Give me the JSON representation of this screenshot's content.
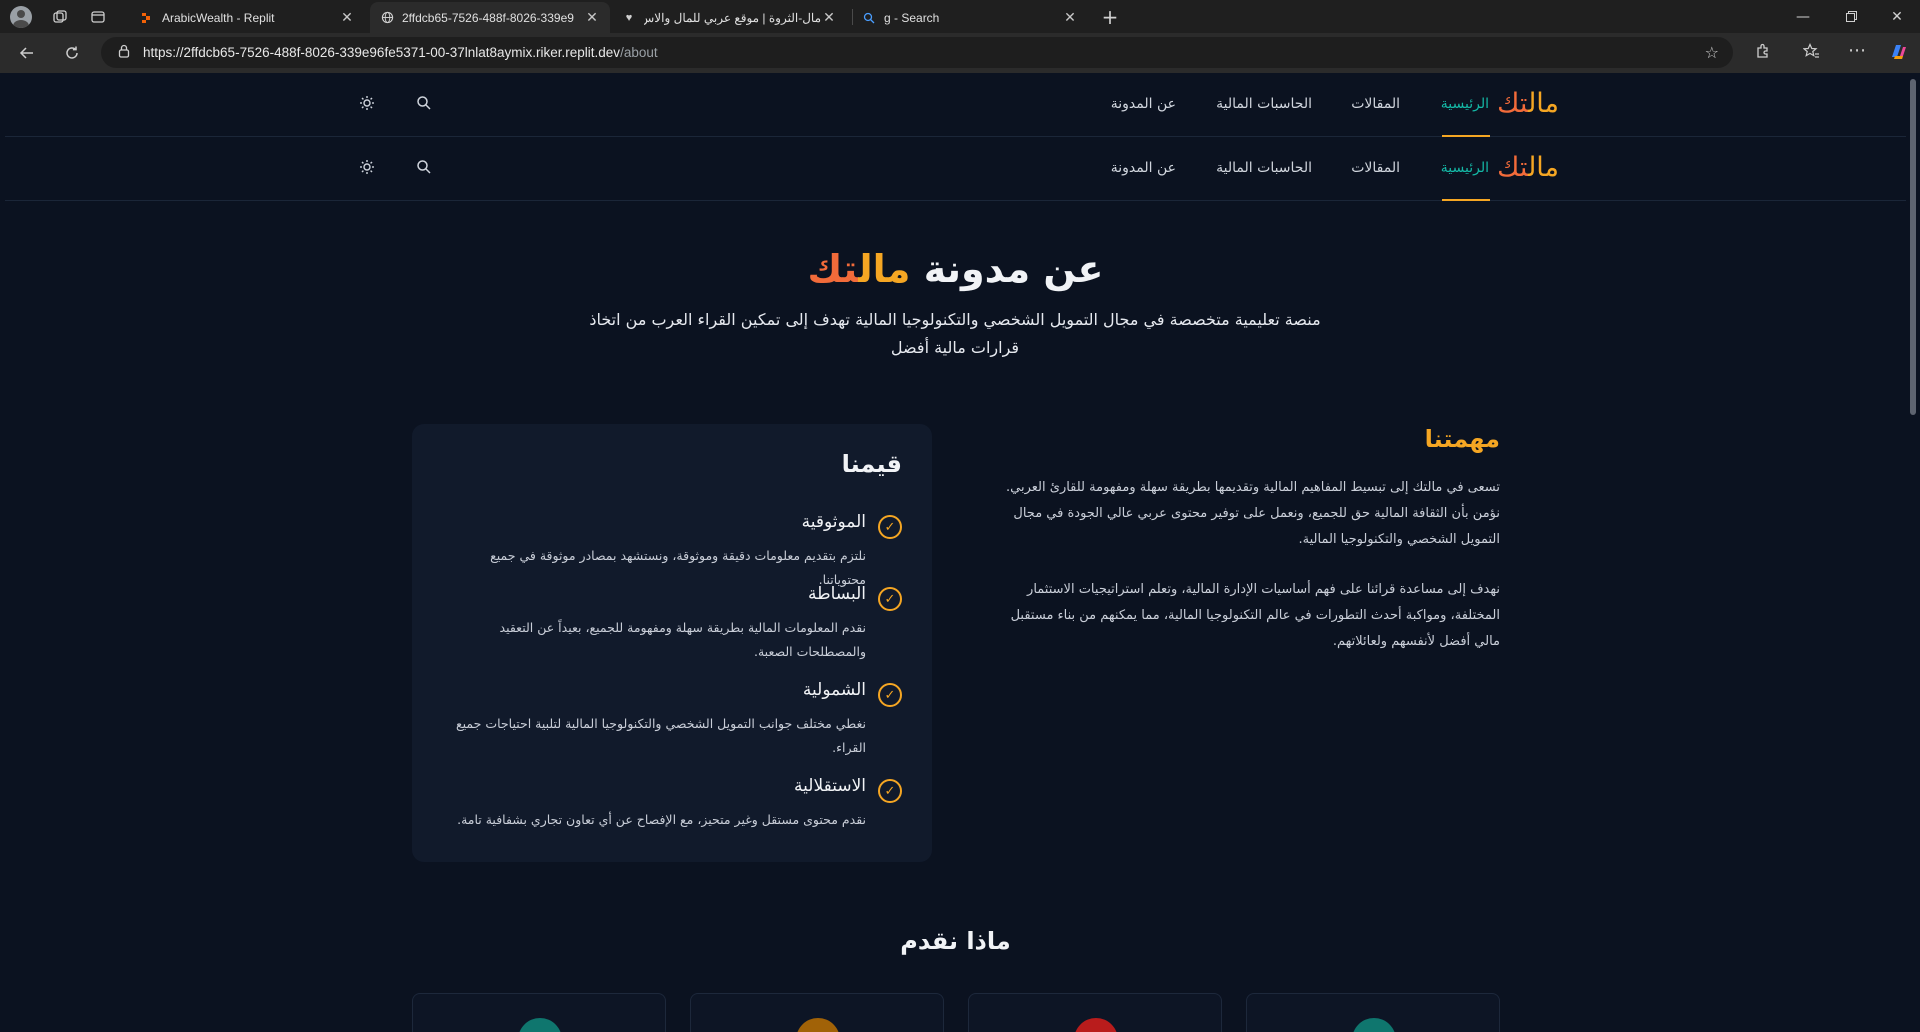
{
  "browser": {
    "tabs": [
      {
        "title": "ArabicWealth - Replit",
        "icon": "replit-icon"
      },
      {
        "title": "2ffdcb65-7526-488f-8026-339e9",
        "icon": "globe-icon"
      },
      {
        "title": "مال-الثروة | موقع عربي للمال والاس",
        "icon": "heart-icon"
      },
      {
        "title": "g - Search",
        "icon": "search-icon"
      }
    ],
    "url_host": "https://2ffdcb65-7526-488f-8026-339e96fe5371-00-37lnlat8aymix.riker.replit.dev",
    "url_path": "/about"
  },
  "site": {
    "logo_part1": "مال",
    "logo_part2": "تك",
    "nav": {
      "home": "الرئيسية",
      "articles": "المقالات",
      "calculators": "الحاسبات المالية",
      "about": "عن المدونة"
    }
  },
  "hero": {
    "title_prefix": "عن مدونة ",
    "title_brand1": "مال",
    "title_brand2": "تك",
    "subtitle": "منصة تعليمية متخصصة في مجال التمويل الشخصي والتكنولوجيا المالية تهدف إلى تمكين القراء العرب من اتخاذ قرارات مالية أفضل"
  },
  "mission": {
    "title": "مهمتنا",
    "p1": "تسعى في مالتك إلى تبسيط المفاهيم المالية وتقديمها بطريقة سهلة ومفهومة للقارئ العربي. نؤمن بأن الثقافة المالية حق للجميع، ونعمل على توفير محتوى عربي عالي الجودة في مجال التمويل الشخصي والتكنولوجيا المالية.",
    "p2": "نهدف إلى مساعدة قرائنا على فهم أساسيات الإدارة المالية، وتعلم استراتيجيات الاستثمار المختلفة، ومواكبة أحدث التطورات في عالم التكنولوجيا المالية، مما يمكنهم من بناء مستقبل مالي أفضل لأنفسهم ولعائلاتهم."
  },
  "values": {
    "title": "قيمنا",
    "items": [
      {
        "title": "الموثوقية",
        "desc": "نلتزم بتقديم معلومات دقيقة وموثوقة، ونستشهد بمصادر موثوقة في جميع محتوياتنا."
      },
      {
        "title": "البساطة",
        "desc": "نقدم المعلومات المالية بطريقة سهلة ومفهومة للجميع، بعيداً عن التعقيد والمصطلحات الصعبة."
      },
      {
        "title": "الشمولية",
        "desc": "نغطي مختلف جوانب التمويل الشخصي والتكنولوجيا المالية لتلبية احتياجات جميع القراء."
      },
      {
        "title": "الاستقلالية",
        "desc": "نقدم محتوى مستقل وغير متحيز، مع الإفصاح عن أي تعاون تجاري بشفافية تامة."
      }
    ]
  },
  "offer": {
    "title": "ماذا نقدم",
    "card_colors": [
      "#0f766e",
      "#a16207",
      "#b91c1c",
      "#0f766e"
    ]
  }
}
